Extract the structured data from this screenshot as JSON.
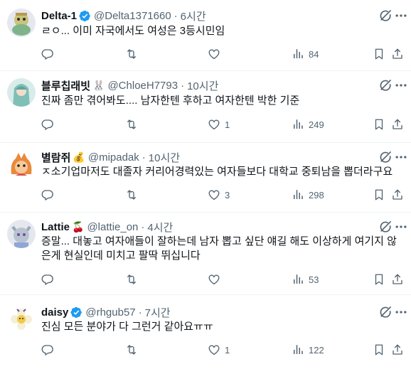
{
  "tweets": [
    {
      "name": "Delta-1",
      "emoji": "",
      "handle": "@Delta1371660",
      "time": "6시간",
      "text": "ㄹㅇ... 이미 자국에서도 여성은 3등시민임",
      "replies": "",
      "retweets": "",
      "likes": "",
      "views": "84"
    },
    {
      "name": "블루칩래빗",
      "emoji": "🐰",
      "handle": "@ChloeH7793",
      "time": "10시간",
      "text": "진짜 좀만 겪어봐도.... 남자한텐 후하고 여자한텐 박한 기준",
      "replies": "",
      "retweets": "",
      "likes": "1",
      "views": "249"
    },
    {
      "name": "별람쥐",
      "emoji": "💰",
      "handle": "@mipadak",
      "time": "10시간",
      "text": "ㅈ소기업마저도 대졸자 커리어경력있는 여자들보다 대학교 중퇴남을 뽑더라구요",
      "replies": "",
      "retweets": "",
      "likes": "3",
      "views": "298"
    },
    {
      "name": "Lattie",
      "emoji": "🍒",
      "handle": "@lattie_on",
      "time": "4시간",
      "text": "증말... 대놓고 여자애들이 잘하는데 남자 뽑고 싶단 얘길 해도 이상하게 여기지 않은게 현실인데 미치고 팔딱 뛰십니다",
      "replies": "",
      "retweets": "",
      "likes": "",
      "views": "53"
    },
    {
      "name": "daisy",
      "emoji": "",
      "handle": "@rhgub57",
      "time": "7시간",
      "text": "진심 모든 분야가 다 그런거 같아요ㅠㅠ",
      "replies": "",
      "retweets": "",
      "likes": "1",
      "views": "122"
    }
  ],
  "colors": {
    "text": "#0f1419",
    "secondary": "#536471",
    "verified": "#1d9bf0",
    "divider": "#eff3f4"
  },
  "icons": [
    "verified-badge-icon",
    "grok-icon",
    "more-icon",
    "reply-icon",
    "retweet-icon",
    "like-icon",
    "views-icon",
    "bookmark-icon",
    "share-icon"
  ]
}
